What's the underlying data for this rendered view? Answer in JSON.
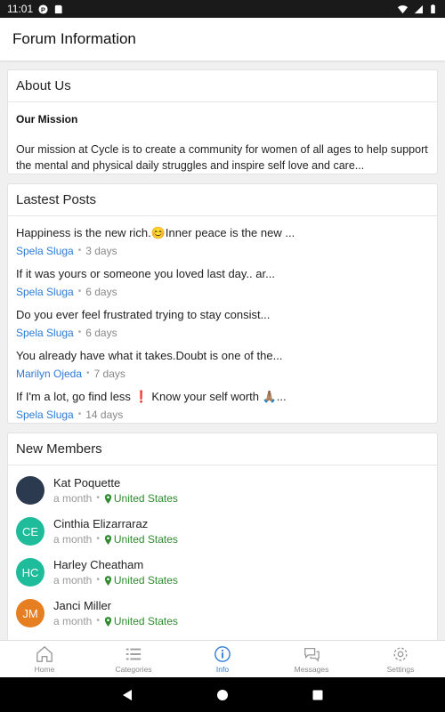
{
  "status_bar": {
    "time": "11:01"
  },
  "app_bar": {
    "title": "Forum Information"
  },
  "about": {
    "header": "About Us",
    "mission_title": "Our Mission",
    "mission_text": "Our mission at Cycle is to create a community for women of all ages to help support the mental and physical daily struggles and inspire self love and care..."
  },
  "posts": {
    "header": "Lastest Posts",
    "items": [
      {
        "title": "Happiness is the new rich.😊Inner peace is the new ...",
        "author": "Spela Sluga",
        "time": "3 days"
      },
      {
        "title": "If it was yours or someone you loved last day.. ar...",
        "author": "Spela Sluga",
        "time": "6 days"
      },
      {
        "title": "Do you ever feel frustrated trying to stay consist...",
        "author": "Spela Sluga",
        "time": "6 days"
      },
      {
        "title": "You already have what it takes.Doubt is one of the...",
        "author": "Marilyn Ojeda",
        "time": "7 days"
      },
      {
        "title": "If I'm a lot, go find less ❗ Know your self worth 🙏🏽...",
        "author": "Spela Sluga",
        "time": "14 days"
      }
    ]
  },
  "members": {
    "header": "New Members",
    "items": [
      {
        "name": "Kat Poquette",
        "initials": "",
        "time": "a month",
        "location": "United States",
        "color": "#2b3a4e"
      },
      {
        "name": "Cinthia Elizarraraz",
        "initials": "CE",
        "time": "a month",
        "location": "United States",
        "color": "#1fbc9c"
      },
      {
        "name": "Harley Cheatham",
        "initials": "HC",
        "time": "a month",
        "location": "United States",
        "color": "#1fbc9c"
      },
      {
        "name": "Janci Miller",
        "initials": "JM",
        "time": "a month",
        "location": "United States",
        "color": "#e67e22"
      }
    ]
  },
  "bottom_nav": {
    "items": [
      {
        "label": "Home",
        "icon": "home-icon"
      },
      {
        "label": "Categories",
        "icon": "list-icon"
      },
      {
        "label": "Info",
        "icon": "info-icon"
      },
      {
        "label": "Messages",
        "icon": "chat-icon"
      },
      {
        "label": "Settings",
        "icon": "gear-icon"
      }
    ],
    "active": "Info"
  },
  "colors": {
    "link": "#2e7bd6",
    "location": "#2e8b2e",
    "active_nav": "#2e7bd6"
  }
}
